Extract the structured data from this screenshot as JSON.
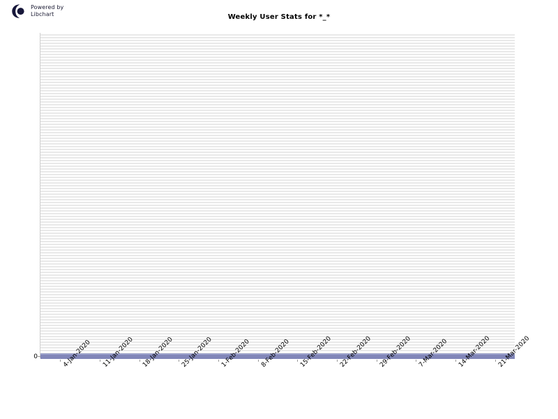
{
  "branding": {
    "logo_icon": "libchart-logo-icon",
    "line1": "Powered by",
    "line2": "Libchart"
  },
  "chart_data": {
    "type": "line",
    "title": "Weekly User Stats for *_*",
    "xlabel": "",
    "ylabel": "",
    "grid": true,
    "legend": "none",
    "ylim": [
      0,
      0
    ],
    "yticks": [
      "0"
    ],
    "categories": [
      "4-Jan-2020",
      "11-Jan-2020",
      "18-Jan-2020",
      "25-Jan-2020",
      "1-Feb-2020",
      "8-Feb-2020",
      "15-Feb-2020",
      "22-Feb-2020",
      "29-Feb-2020",
      "7-Mar-2020",
      "14-Mar-2020",
      "21-Mar-2020"
    ],
    "values": [
      0,
      0,
      0,
      0,
      0,
      0,
      0,
      0,
      0,
      0,
      0,
      0
    ],
    "series_color": "#8186b8",
    "plot_background": "#ffffff",
    "grid_stripe_color": "#e9e9e9"
  }
}
